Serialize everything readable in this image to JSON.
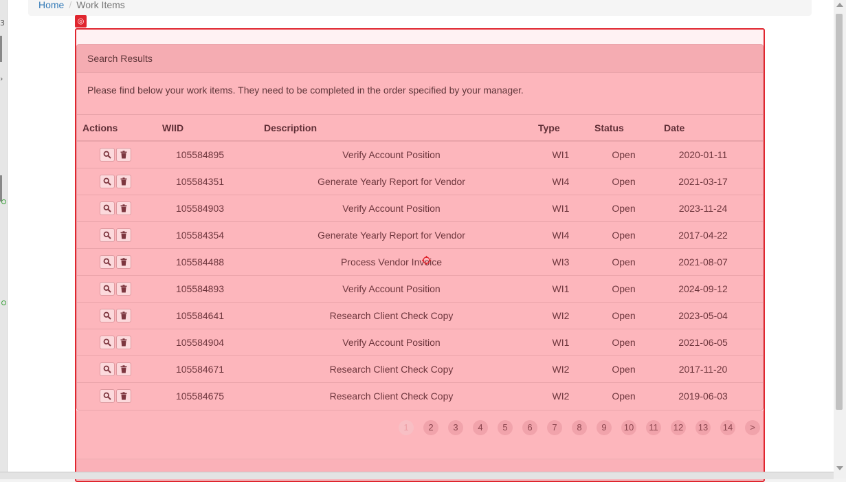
{
  "breadcrumb": {
    "home": "Home",
    "separator": "/",
    "current": "Work Items"
  },
  "panel": {
    "heading": "Search Results",
    "intro": "Please find below your work items. They need to be completed in the order specified by your manager."
  },
  "table": {
    "headers": {
      "actions": "Actions",
      "wiid": "WIID",
      "description": "Description",
      "type": "Type",
      "status": "Status",
      "date": "Date"
    },
    "rows": [
      {
        "wiid": "105584895",
        "description": "Verify Account Position",
        "type": "WI1",
        "status": "Open",
        "date": "2020-01-11"
      },
      {
        "wiid": "105584351",
        "description": "Generate Yearly Report for Vendor",
        "type": "WI4",
        "status": "Open",
        "date": "2021-03-17"
      },
      {
        "wiid": "105584903",
        "description": "Verify Account Position",
        "type": "WI1",
        "status": "Open",
        "date": "2023-11-24"
      },
      {
        "wiid": "105584354",
        "description": "Generate Yearly Report for Vendor",
        "type": "WI4",
        "status": "Open",
        "date": "2017-04-22"
      },
      {
        "wiid": "105584488",
        "description": "Process Vendor Invoice",
        "type": "WI3",
        "status": "Open",
        "date": "2021-08-07"
      },
      {
        "wiid": "105584893",
        "description": "Verify Account Position",
        "type": "WI1",
        "status": "Open",
        "date": "2024-09-12"
      },
      {
        "wiid": "105584641",
        "description": "Research Client Check Copy",
        "type": "WI2",
        "status": "Open",
        "date": "2023-05-04"
      },
      {
        "wiid": "105584904",
        "description": "Verify Account Position",
        "type": "WI1",
        "status": "Open",
        "date": "2021-06-05"
      },
      {
        "wiid": "105584671",
        "description": "Research Client Check Copy",
        "type": "WI2",
        "status": "Open",
        "date": "2017-11-20"
      },
      {
        "wiid": "105584675",
        "description": "Research Client Check Copy",
        "type": "WI2",
        "status": "Open",
        "date": "2019-06-03"
      }
    ],
    "row_actions": [
      "search-icon",
      "trash-icon"
    ]
  },
  "pagination": {
    "pages": [
      "1",
      "2",
      "3",
      "4",
      "5",
      "6",
      "7",
      "8",
      "9",
      "10",
      "11",
      "12",
      "13",
      "14"
    ],
    "current": "1",
    "next": ">"
  },
  "highlight": {
    "color": "#e0262f",
    "badge_icon": "target-icon"
  }
}
